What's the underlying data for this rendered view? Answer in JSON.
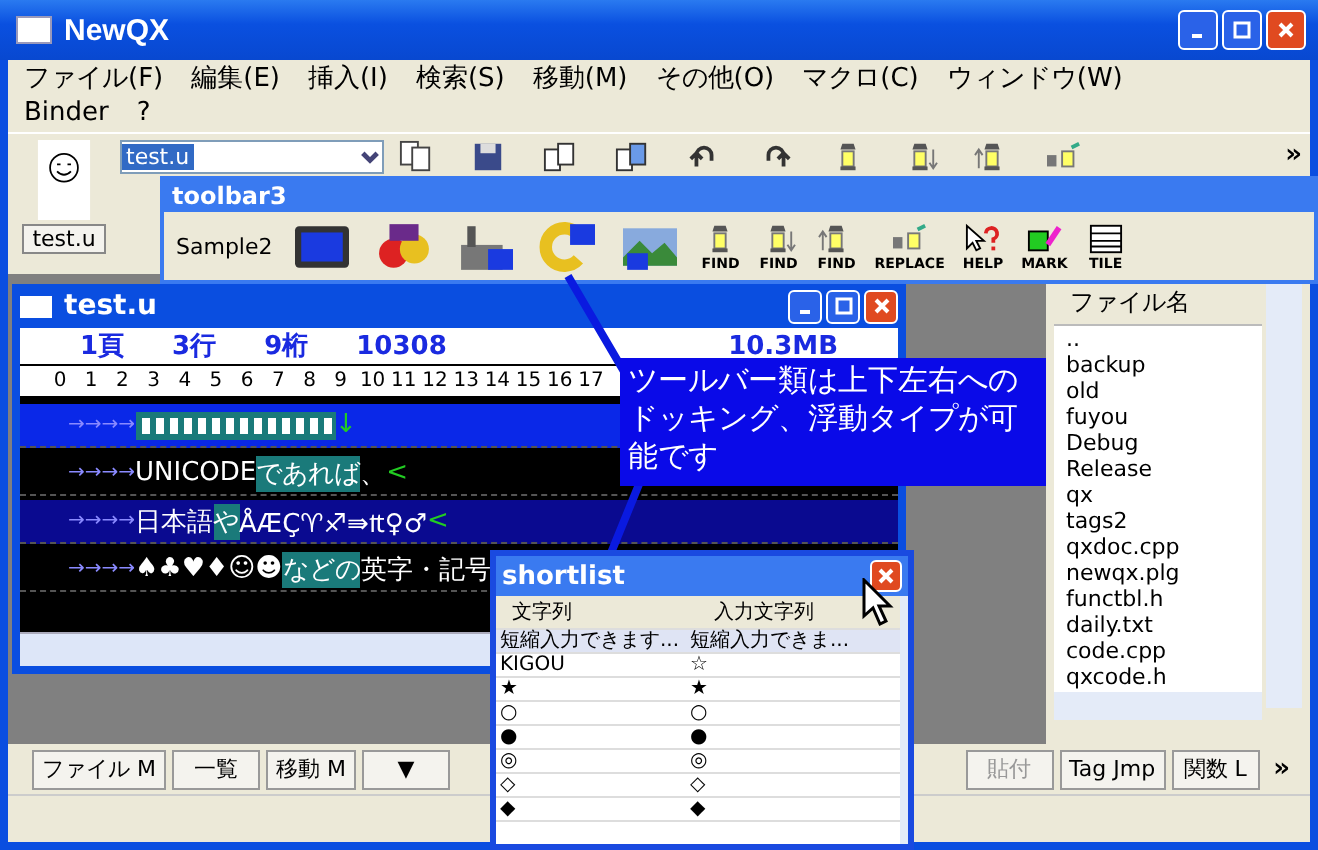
{
  "window": {
    "title": "NewQX"
  },
  "menu": [
    [
      {
        "label": "ファイル(F)"
      },
      {
        "label": "編集(E)"
      },
      {
        "label": "挿入(I)"
      },
      {
        "label": "検索(S)"
      },
      {
        "label": "移動(M)"
      },
      {
        "label": "その他(O)"
      },
      {
        "label": "マクロ(C)"
      },
      {
        "label": "ウィンドウ(W)"
      }
    ],
    [
      {
        "label": "Binder"
      },
      {
        "label": "?"
      }
    ]
  ],
  "toolbar": {
    "combo_value": "test.u",
    "tab": "test.u",
    "buttons": [
      {
        "kind": "open"
      },
      {
        "kind": "save"
      },
      {
        "kind": "list"
      },
      {
        "kind": "list2"
      },
      {
        "kind": "undo"
      },
      {
        "kind": "redo"
      },
      {
        "kind": "find"
      },
      {
        "kind": "finddown"
      },
      {
        "kind": "findup"
      },
      {
        "kind": "replace"
      }
    ],
    "more": "»"
  },
  "toolbar3": {
    "title": "toolbar3",
    "label": "Sample2",
    "buttons": [
      {
        "kind": "msdos"
      },
      {
        "kind": "msdos2"
      },
      {
        "kind": "factory"
      },
      {
        "kind": "c"
      },
      {
        "kind": "landscape"
      },
      {
        "kind": "find",
        "label": "FIND"
      },
      {
        "kind": "finddown",
        "label": "FIND"
      },
      {
        "kind": "findup",
        "label": "FIND"
      },
      {
        "kind": "replace",
        "label": "REPLACE"
      },
      {
        "kind": "help",
        "label": "HELP"
      },
      {
        "kind": "mark",
        "label": "MARK"
      },
      {
        "kind": "tile",
        "label": "TILE"
      }
    ]
  },
  "editor": {
    "title": "test.u",
    "status": [
      "1頁",
      "3行",
      "9桁",
      "10308",
      "10.3MB"
    ],
    "ruler": [
      "0",
      "1",
      "2",
      "3",
      "4",
      "5",
      "6",
      "7",
      "8",
      "9",
      "10",
      "11",
      "12",
      "13",
      "14",
      "15",
      "16",
      "17"
    ],
    "lines": [
      {
        "color": "#0a28e8",
        "segments": [
          {
            "kind": "tab",
            "text": "→→→→"
          },
          {
            "kind": "glyphs"
          },
          {
            "kind": "end",
            "text": "↓"
          }
        ]
      },
      {
        "color": "#000000",
        "segments": [
          {
            "kind": "tab",
            "text": "→→→→"
          },
          {
            "kind": "text",
            "text": "UNICODE "
          },
          {
            "kind": "highlight",
            "text": "であれば"
          },
          {
            "kind": "text",
            "text": "、"
          },
          {
            "kind": "end",
            "text": "<"
          }
        ]
      },
      {
        "color": "#0a0a90",
        "segments": [
          {
            "kind": "tab",
            "text": "→→→→"
          },
          {
            "kind": "text",
            "text": "日本語"
          },
          {
            "kind": "highlight",
            "text": "や"
          },
          {
            "kind": "text",
            "text": "ÅÆÇ♈♐⇛₶♀♂"
          },
          {
            "kind": "end",
            "text": "<"
          }
        ]
      },
      {
        "color": "#000000",
        "segments": [
          {
            "kind": "tab",
            "text": "→→→→"
          },
          {
            "kind": "text",
            "text": "♠♣♥♦☺☻ "
          },
          {
            "kind": "highlight",
            "text": "などの"
          },
          {
            "kind": "text",
            "text": "英字・記号"
          }
        ]
      }
    ]
  },
  "callout": {
    "text": "ツールバー類は上下左右へのドッキング、浮動タイプが可能です"
  },
  "file_pane": {
    "header": "ファイル名",
    "items": [
      "..",
      "backup",
      "old",
      "fuyou",
      "Debug",
      "Release",
      "qx",
      "tags2",
      "qxdoc.cpp",
      "newqx.plg",
      "functbl.h",
      "daily.txt",
      "code.cpp",
      "qxcode.h"
    ]
  },
  "shortlist": {
    "title": "shortlist",
    "columns": [
      "文字列",
      "入力文字列"
    ],
    "rows": [
      {
        "key": "短縮入力できます...",
        "value": "短縮入力できま...",
        "selected": true
      },
      {
        "key": "KIGOU",
        "value": "☆",
        "selected": false
      },
      {
        "key": "★",
        "value": "★",
        "selected": false
      },
      {
        "key": "○",
        "value": "○",
        "selected": false
      },
      {
        "key": "●",
        "value": "●",
        "selected": false
      },
      {
        "key": "◎",
        "value": "◎",
        "selected": false
      },
      {
        "key": "◇",
        "value": "◇",
        "selected": false
      },
      {
        "key": "◆",
        "value": "◆",
        "selected": false
      }
    ]
  },
  "bottom_toolbar": {
    "buttons": [
      {
        "label": "ファイル M",
        "disabled": false
      },
      {
        "label": "一覧",
        "disabled": false
      },
      {
        "label": "移動 M",
        "disabled": false
      },
      {
        "label": "▼",
        "disabled": false
      }
    ],
    "right_buttons": [
      {
        "label": "貼付",
        "disabled": true
      },
      {
        "label": "Tag Jmp",
        "disabled": false
      },
      {
        "label": "関数 L",
        "disabled": false
      }
    ],
    "more": "»"
  }
}
